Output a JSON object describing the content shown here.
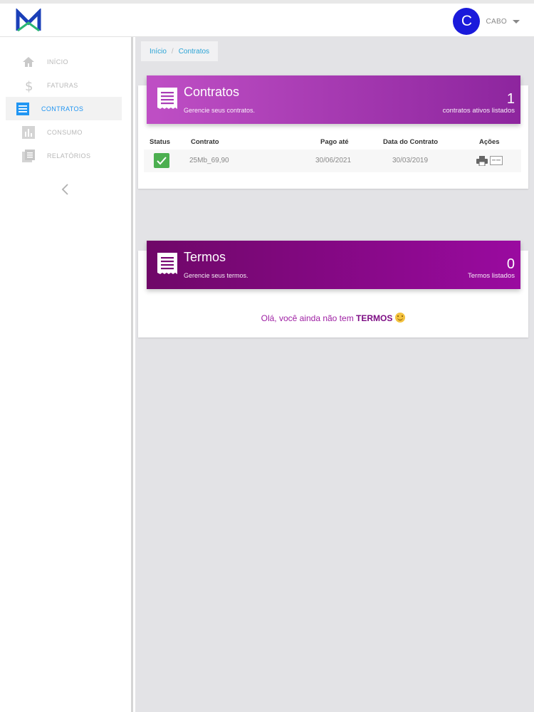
{
  "header": {
    "user_initial": "C",
    "user_name": "CABO"
  },
  "sidebar": {
    "items": [
      {
        "label": "INÍCIO",
        "icon": "home-icon",
        "active": false
      },
      {
        "label": "FATURAS",
        "icon": "dollar-icon",
        "active": false
      },
      {
        "label": "CONTRATOS",
        "icon": "list-icon",
        "active": true
      },
      {
        "label": "CONSUMO",
        "icon": "bar-chart-icon",
        "active": false
      },
      {
        "label": "RELATÓRIOS",
        "icon": "report-icon",
        "active": false
      }
    ],
    "collapse_icon": "chevron-left-icon"
  },
  "breadcrumb": {
    "home": "Início",
    "separator": "/",
    "current": "Contratos"
  },
  "contracts": {
    "title": "Contratos",
    "subtitle": "Gerencie seus contratos.",
    "count": "1",
    "count_label": "contratos ativos listados",
    "columns": {
      "status": "Status",
      "contract": "Contrato",
      "paid_until": "Pago até",
      "contract_date": "Data do Contrato",
      "actions": "Ações"
    },
    "rows": [
      {
        "status": "active",
        "contract": "25Mb_69,90",
        "paid_until": "30/06/2021",
        "contract_date": "30/03/2019"
      }
    ]
  },
  "terms": {
    "title": "Termos",
    "subtitle": "Gerencie seus termos.",
    "count": "0",
    "count_label": "Termos listados",
    "empty_prefix": "Olá, você ainda não tem ",
    "empty_bold": "TERMOS"
  },
  "colors": {
    "primary_blue": "#2196f3",
    "avatar": "#1a1adb",
    "contracts_band_start": "#bf4fc5",
    "contracts_band_end": "#8d259e",
    "terms_band_start": "#6f0768",
    "terms_band_end": "#9a0aa0",
    "success": "#4caf50"
  }
}
